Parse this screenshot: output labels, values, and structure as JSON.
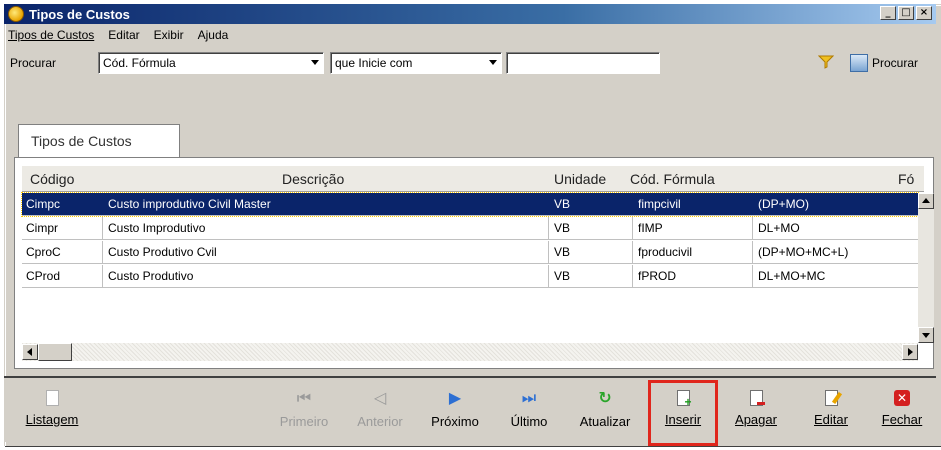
{
  "window": {
    "title": "Tipos de Custos",
    "controls": [
      "_",
      "□",
      "×"
    ]
  },
  "menu": [
    "Tipos de Custos",
    "Editar",
    "Exibir",
    "Ajuda"
  ],
  "search": {
    "label": "Procurar",
    "field_value": "Cód. Fórmula",
    "operator_value": "que Inicie com",
    "text_value": "",
    "button_label": "Procurar"
  },
  "tab": {
    "label": "Tipos de Custos"
  },
  "table": {
    "columns": [
      "Código",
      "Descrição",
      "Unidade",
      "Cód. Fórmula",
      "Fó"
    ],
    "rows": [
      {
        "codigo": "Cimpc",
        "descricao": "Custo improdutivo Civil Master",
        "unidade": "VB",
        "cod_formula": "fimpcivil",
        "formula": "(DP+MO)",
        "selected": true
      },
      {
        "codigo": "Cimpr",
        "descricao": "Custo Improdutivo",
        "unidade": "VB",
        "cod_formula": "fIMP",
        "formula": "DL+MO",
        "selected": false
      },
      {
        "codigo": "CproC",
        "descricao": "Custo Produtivo Cvil",
        "unidade": "VB",
        "cod_formula": "fproducivil",
        "formula": "(DP+MO+MC+L)",
        "selected": false
      },
      {
        "codigo": "CProd",
        "descricao": "Custo Produtivo",
        "unidade": "VB",
        "cod_formula": "fPROD",
        "formula": "DL+MO+MC",
        "selected": false
      }
    ]
  },
  "toolbar": {
    "listagem": "Listagem",
    "primeiro": "Primeiro",
    "anterior": "Anterior",
    "proximo": "Próximo",
    "ultimo": "Último",
    "atualizar": "Atualizar",
    "inserir": "Inserir",
    "apagar": "Apagar",
    "editar": "Editar",
    "fechar": "Fechar"
  },
  "colors": {
    "selection": "#0a246a",
    "highlight_box": "#e0261c",
    "nav_blue": "#2d6fd3",
    "refresh_green": "#2aa52a"
  }
}
